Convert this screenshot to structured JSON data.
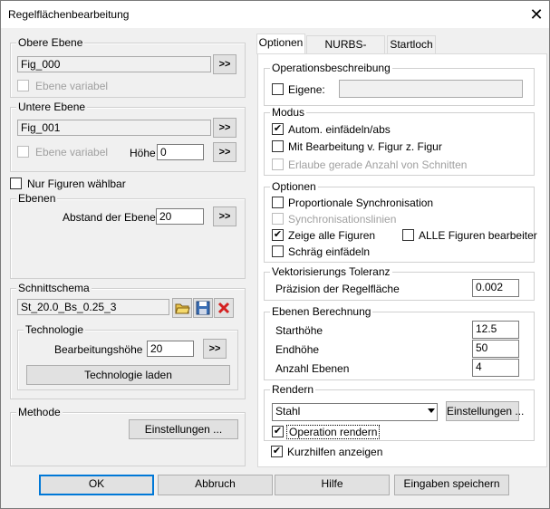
{
  "window": {
    "title": "Regelflächenbearbeitung",
    "close_glyph": "✕"
  },
  "left": {
    "obere_ebene": {
      "legend": "Obere Ebene",
      "value": "Fig_000",
      "btn": ">>",
      "cb_label": "Ebene variabel"
    },
    "untere_ebene": {
      "legend": "Untere Ebene",
      "value": "Fig_001",
      "btn": ">>",
      "cb_label": "Ebene variabel",
      "hoehe_label": "Höhe",
      "hoehe_value": "0",
      "hoehe_btn": ">>"
    },
    "nur_figuren": "Nur Figuren wählbar",
    "ebenen": {
      "legend": "Ebenen",
      "abstand_label": "Abstand der Ebenen",
      "abstand_value": "20",
      "btn": ">>"
    },
    "schnittschema": {
      "legend": "Schnittschema",
      "value": "St_20.0_Bs_0.25_3",
      "technologie": {
        "legend": "Technologie",
        "label": "Bearbeitungshöhe",
        "value": "20",
        "btn": ">>",
        "laden": "Technologie laden"
      }
    },
    "methode": {
      "legend": "Methode",
      "btn": "Einstellungen ..."
    }
  },
  "tabs": [
    {
      "label": "Optionen"
    },
    {
      "label": "NURBS-Surface"
    },
    {
      "label": "Startloch"
    }
  ],
  "right": {
    "operationsbeschreibung": {
      "legend": "Operationsbeschreibung",
      "eigene": "Eigene:",
      "value": ""
    },
    "modus": {
      "legend": "Modus",
      "autom": "Autom. einfädeln/abs",
      "mit_bearb": "Mit Bearbeitung v. Figur z. Figur",
      "erlaube": "Erlaube gerade Anzahl von Schnitten"
    },
    "optionen": {
      "legend": "Optionen",
      "prop": "Proportionale Synchronisation",
      "synclinien": "Synchronisationslinien",
      "zeige": "Zeige alle Figuren",
      "alle": "ALLE Figuren bearbeiter",
      "schraeg": "Schräg einfädeln"
    },
    "vektor": {
      "legend": "Vektorisierungs Toleranz",
      "label": "Präzision der Regelfläche",
      "value": "0.002"
    },
    "ebenen_berechnung": {
      "legend": "Ebenen Berechnung",
      "start_label": "Starthöhe",
      "start_value": "12.5",
      "end_label": "Endhöhe",
      "end_value": "50",
      "anzahl_label": "Anzahl Ebenen",
      "anzahl_value": "4"
    },
    "rendern": {
      "legend": "Rendern",
      "select": "Stahl",
      "einstellungen": "Einstellungen ...",
      "operation": "Operation rendern"
    },
    "kurzhilfen": "Kurzhilfen anzeigen"
  },
  "footer": {
    "ok": "OK",
    "abbruch": "Abbruch",
    "hilfe": "Hilfe",
    "speichern": "Eingaben speichern"
  },
  "check": "✔"
}
